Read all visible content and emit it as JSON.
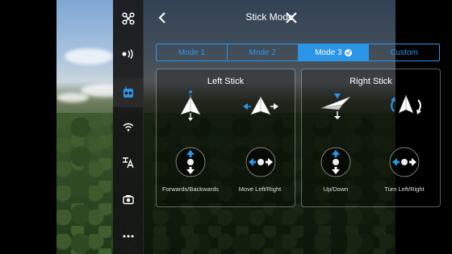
{
  "header": {
    "title": "Stick Mode"
  },
  "tabs": [
    {
      "label": "Mode 1",
      "active": false
    },
    {
      "label": "Mode 2",
      "active": false
    },
    {
      "label": "Mode 3",
      "active": true
    },
    {
      "label": "Custom",
      "active": false
    }
  ],
  "sidebar": {
    "items": [
      {
        "icon": "drone-icon"
      },
      {
        "icon": "signal-icon"
      },
      {
        "icon": "remote-controller-icon",
        "active": true
      },
      {
        "icon": "wifi-icon"
      },
      {
        "icon": "language-icon"
      },
      {
        "icon": "camera-icon"
      },
      {
        "icon": "more-icon"
      }
    ]
  },
  "left_stick": {
    "title": "Left Stick",
    "captions": [
      "Forwards/Backwards",
      "Move Left/Right"
    ]
  },
  "right_stick": {
    "title": "Right Stick",
    "captions": [
      "Up/Down",
      "Turn Left/Right"
    ]
  },
  "colors": {
    "accent": "#2b95e8",
    "panel": "#000000"
  }
}
